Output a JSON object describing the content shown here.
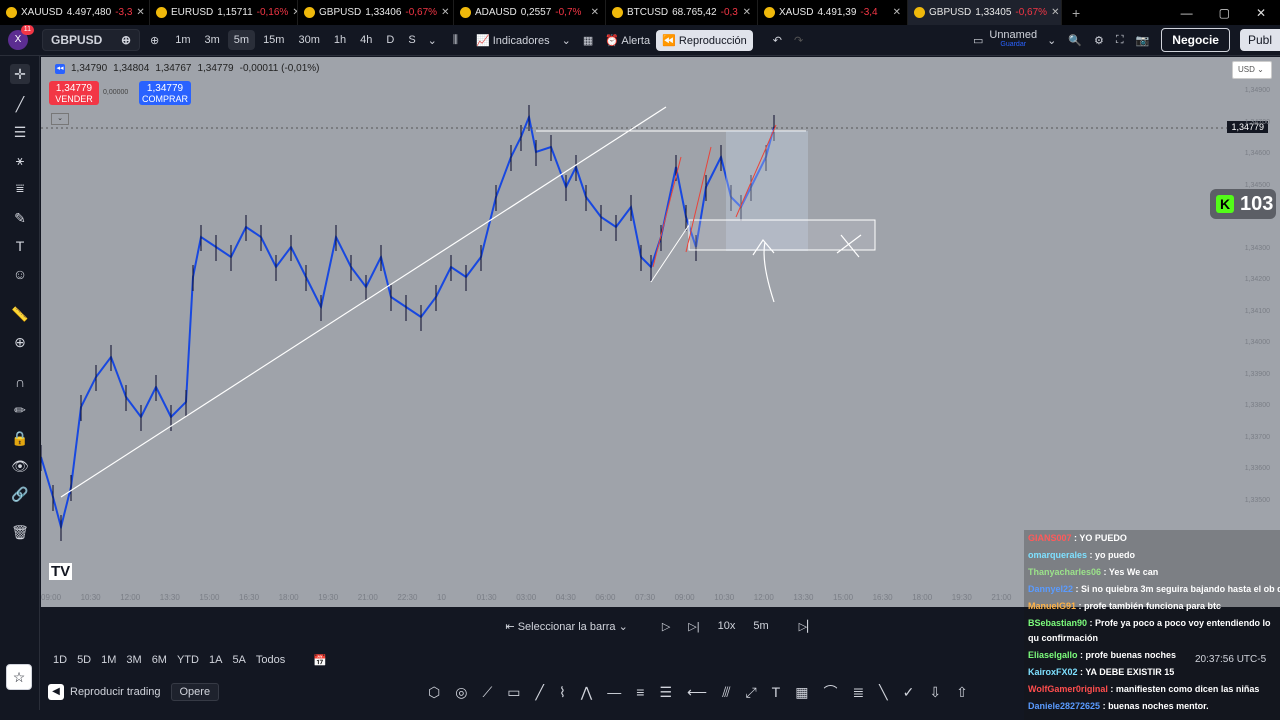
{
  "tabs": [
    {
      "symbol": "XAUUSD",
      "price": "4.497,480",
      "change": "-3,3",
      "active": false
    },
    {
      "symbol": "EURUSD",
      "price": "1,15711",
      "change": "-0,16%",
      "active": false
    },
    {
      "symbol": "GBPUSD",
      "price": "1,33406",
      "change": "-0,67%",
      "active": false
    },
    {
      "symbol": "ADAUSD",
      "price": "0,2557",
      "change": "-0,7%",
      "active": false
    },
    {
      "symbol": "BTCUSD",
      "price": "68.765,42",
      "change": "-0,3",
      "active": false
    },
    {
      "symbol": "XAUSD",
      "price": "4.491,39",
      "change": "-3,4",
      "active": false
    },
    {
      "symbol": "GBPUSD",
      "price": "1,33405",
      "change": "-0,67%",
      "active": true
    }
  ],
  "toolbar": {
    "notification_count": "11",
    "symbol": "GBPUSD",
    "timeframes": [
      "1m",
      "3m",
      "5m",
      "15m",
      "30m",
      "1h",
      "4h",
      "D",
      "S"
    ],
    "selected_timeframe": "5m",
    "indicators_label": "Indicadores",
    "alert_label": "Alerta",
    "replay_label": "Reproducción",
    "layout_name": "Unnamed",
    "layout_status": "Guardar",
    "trade_label": "Negocie",
    "publish_label": "Publ"
  },
  "chart": {
    "ohlc": [
      "1,34790",
      "1,34804",
      "1,34767",
      "1,34779",
      "-0,00011 (-0,01%)"
    ],
    "sell_price": "1,34779",
    "sell_label": "VENDER",
    "spread": "0,00000",
    "buy_price": "1,34779",
    "buy_label": "COMPRAR",
    "currency": "USD",
    "current_price": "1,34779",
    "kick_count": "103",
    "tv_logo": "TV",
    "y_ticks": [
      "1,34900",
      "1,34700",
      "1,34600",
      "1,34500",
      "1,34400",
      "1,34300",
      "1,34200",
      "1,34100",
      "1,34000",
      "1,33900",
      "1,33800",
      "1,33700",
      "1,33600",
      "1,33500"
    ],
    "x_ticks": [
      "09:00",
      "10:30",
      "12:00",
      "13:30",
      "15:00",
      "16:30",
      "18:00",
      "19:30",
      "21:00",
      "22:30",
      "10",
      "01:30",
      "03:00",
      "04:30",
      "06:00",
      "07:30",
      "09:00",
      "10:30",
      "12:00",
      "13:30",
      "15:00",
      "16:30",
      "18:00",
      "19:30",
      "21:00"
    ]
  },
  "replay": {
    "select_bar": "Seleccionar la barra",
    "speed": "10x",
    "interval": "5m"
  },
  "bottom": {
    "ranges": [
      "1D",
      "5D",
      "1M",
      "3M",
      "6M",
      "YTD",
      "1A",
      "5A",
      "Todos"
    ],
    "play_trading": "Reproducir trading",
    "opere": "Opere",
    "time": "20:37:56 UTC-5"
  },
  "chat": [
    {
      "user": "GIANS007",
      "msg": "YO PUEDO",
      "color": "#ff5a5a"
    },
    {
      "user": "omarquerales",
      "msg": "yo puedo",
      "color": "#7ee0ff"
    },
    {
      "user": "Thanyacharles06",
      "msg": "Yes We can",
      "color": "#9be28a"
    },
    {
      "user": "Dannyel22",
      "msg": "Si no quiebra 3m seguira bajando hasta el ob d",
      "color": "#5a9bff"
    },
    {
      "user": "ManuelG91",
      "msg": "profe también funciona para btc",
      "color": "#ffb347"
    },
    {
      "user": "BSebastian90",
      "msg": "Profe ya poco a poco voy entendiendo lo qu confirmación",
      "color": "#7cfc7c"
    },
    {
      "user": "Eliaselgallo",
      "msg": "profe buenas noches",
      "color": "#7cfc7c"
    },
    {
      "user": "KairoxFX02",
      "msg": "YA DEBE EXISTIR 15",
      "color": "#7ee0ff"
    },
    {
      "user": "WolfGamer0riginal",
      "msg": "manifiesten como dicen las niñas",
      "color": "#ff4d4d"
    },
    {
      "user": "Daniele28272625",
      "msg": "buenas noches mentor.",
      "color": "#5a9bff"
    }
  ]
}
